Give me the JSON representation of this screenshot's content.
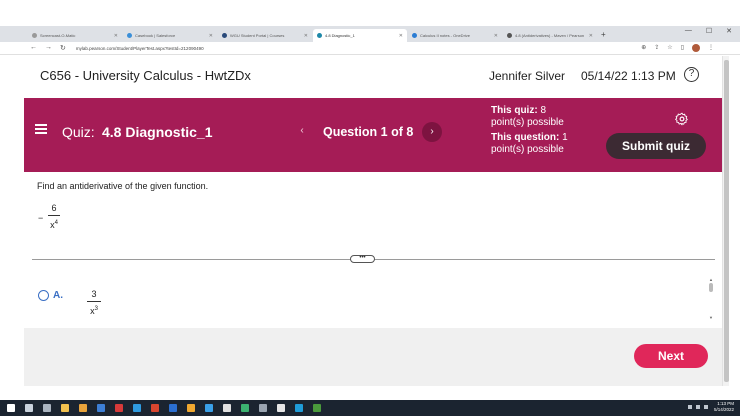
{
  "browser": {
    "tabs": [
      {
        "label": "Screencast-O-Matic",
        "active": false
      },
      {
        "label": "Casebook | Salesforce",
        "active": false
      },
      {
        "label": "WGU Student Portal | Courses",
        "active": false
      },
      {
        "label": "4.8 Diagnostic_1",
        "active": true
      },
      {
        "label": "Calculus II notes - OneDrive",
        "active": false
      },
      {
        "label": "4.8 (Antiderivatives) - Maven / Pearson",
        "active": false
      }
    ],
    "new_tab": "+",
    "url": "mylab.pearson.com/Student/PlayerTest.aspx?testId=212090490",
    "nav": {
      "back": "←",
      "forward": "→",
      "reload": "↻"
    },
    "window_controls": {
      "min": "—",
      "max": "☐",
      "close": "✕"
    }
  },
  "header": {
    "course_title": "C656 - University Calculus - HwtZDx",
    "user_name": "Jennifer Silver",
    "datetime": "05/14/22 1:13 PM",
    "help": "?"
  },
  "quiz_bar": {
    "quiz_label": "Quiz:",
    "quiz_name": "4.8 Diagnostic_1",
    "prev": "‹",
    "question": "Question 1 of 8",
    "next": "›",
    "this_quiz_label": "This quiz:",
    "this_quiz_value": "8",
    "this_quiz_suffix": "point(s) possible",
    "this_question_label": "This question:",
    "this_question_value": "1",
    "this_question_suffix": "point(s) possible",
    "submit": "Submit quiz"
  },
  "question": {
    "instruction": "Find an antiderivative of the given function.",
    "sign": "−",
    "numerator": "6",
    "denominator_base": "x",
    "denominator_exp": "4"
  },
  "divider_handle": "•••",
  "options": [
    {
      "letter": "A.",
      "numerator": "3",
      "denominator_base": "x",
      "denominator_exp": "3"
    }
  ],
  "footer": {
    "next": "Next"
  },
  "taskbar": {
    "time": "1:13 PM",
    "date": "5/14/2022"
  }
}
